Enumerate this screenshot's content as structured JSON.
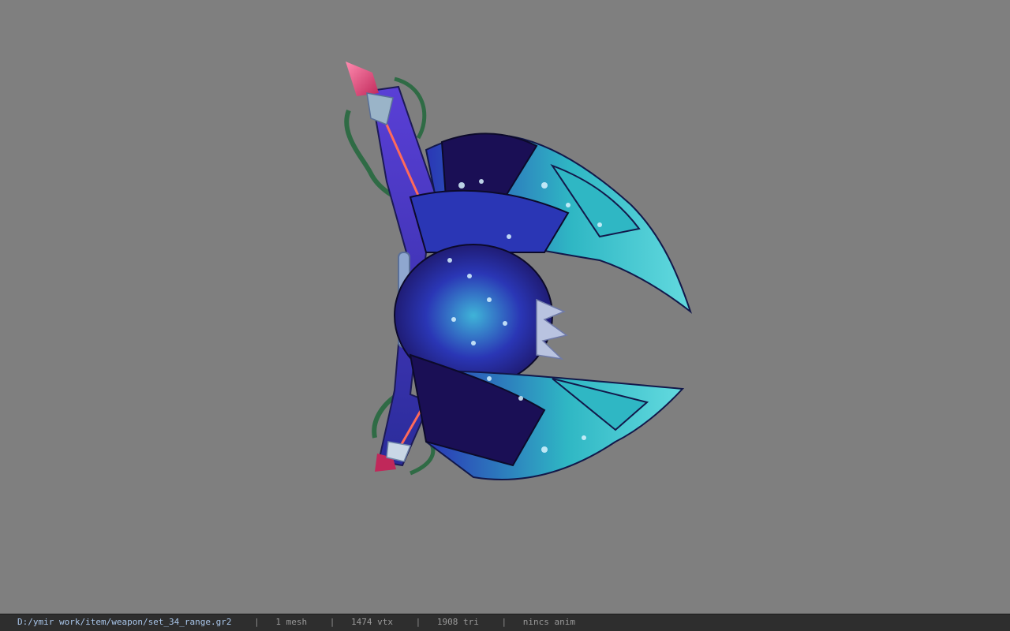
{
  "window": {
    "background_color": "#7f7f7f"
  },
  "model": {
    "icon": "bow-weapon-model",
    "colors": {
      "deep_purple": "#1a0f55",
      "royal_blue": "#2a36b5",
      "teal": "#2fb7c4",
      "light_teal": "#63dadf",
      "stem_green": "#2f6b45",
      "crystal": "#e04a7a",
      "string": "#ff6a5a"
    }
  },
  "status": {
    "file_path": "D:/ymir work/item/weapon/set_34_range.gr2",
    "separator": "|",
    "mesh_count": "1 mesh",
    "vertex_count": "1474 vtx",
    "triangle_count": "1908 tri",
    "animation": "nincs anim"
  }
}
